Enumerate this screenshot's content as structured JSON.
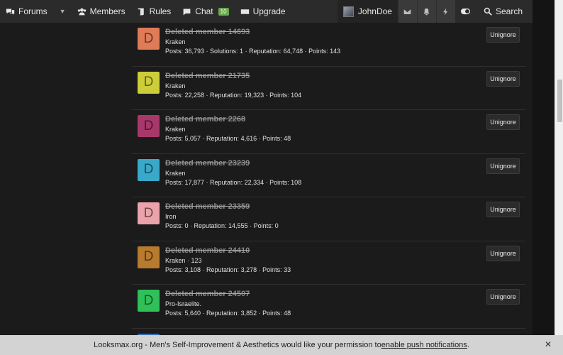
{
  "nav": {
    "forums": "Forums",
    "members": "Members",
    "rules": "Rules",
    "chat": "Chat",
    "chat_badge": "10",
    "upgrade": "Upgrade",
    "username": "JohnDoe",
    "search": "Search"
  },
  "button_label": "Unignore",
  "members": [
    {
      "name": "Deleted member 14693",
      "letter": "D",
      "color": "#e07b57",
      "title": "Kraken",
      "stats": "Posts: 36,793 · Solutions: 1 · Reputation: 64,748 · Points: 143"
    },
    {
      "name": "Deleted member 21735",
      "letter": "D",
      "color": "#cdcd3a",
      "title": "Kraken",
      "stats": "Posts: 22,258 · Reputation: 19,323 · Points: 104"
    },
    {
      "name": "Deleted member 2268",
      "letter": "D",
      "color": "#a8386a",
      "title": "Kraken",
      "stats": "Posts: 5,057 · Reputation: 4,616 · Points: 48"
    },
    {
      "name": "Deleted member 23239",
      "letter": "D",
      "color": "#39a9c9",
      "title": "Kraken",
      "stats": "Posts: 17,877 · Reputation: 22,334 · Points: 108"
    },
    {
      "name": "Deleted member 23359",
      "letter": "D",
      "color": "#eba3ab",
      "title": "Iron",
      "stats": "Posts: 0 · Reputation: 14,555 · Points: 0"
    },
    {
      "name": "Deleted member 24410",
      "letter": "D",
      "color": "#b87a2e",
      "title": "Kraken · 123",
      "stats": "Posts: 3,108 · Reputation: 3,278 · Points: 33"
    },
    {
      "name": "Deleted member 24507",
      "letter": "D",
      "color": "#2fc05a",
      "title": "Pro-Israelite.",
      "stats": "Posts: 5,640 · Reputation: 3,852 · Points: 48"
    }
  ],
  "notice": {
    "text": "Looksmax.org - Men's Self-Improvement & Aesthetics would like your permission to ",
    "link": "enable push notifications",
    "end": ".",
    "close": "✕"
  }
}
